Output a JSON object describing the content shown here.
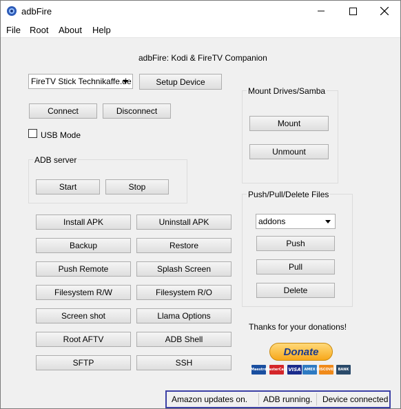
{
  "window": {
    "title": "adbFire"
  },
  "menu": [
    "File",
    "Root",
    "About",
    "Help"
  ],
  "header": "adbFire:  Kodi & FireTV  Companion",
  "device_select": {
    "value": "FireTV Stick Technikaffe.de"
  },
  "buttons": {
    "setup_device": "Setup Device",
    "connect": "Connect",
    "disconnect": "Disconnect",
    "start": "Start",
    "stop": "Stop",
    "install_apk": "Install APK",
    "uninstall_apk": "Uninstall APK",
    "backup": "Backup",
    "restore": "Restore",
    "push_remote": "Push Remote",
    "splash_screen": "Splash Screen",
    "filesystem_rw": "Filesystem R/W",
    "filesystem_ro": "Filesystem R/O",
    "screen_shot": "Screen shot",
    "llama_options": "Llama Options",
    "root_aftv": "Root AFTV",
    "adb_shell": "ADB Shell",
    "sftp": "SFTP",
    "ssh": "SSH",
    "mount": "Mount",
    "unmount": "Unmount",
    "push": "Push",
    "pull": "Pull",
    "delete": "Delete"
  },
  "usb_mode": {
    "label": "USB Mode",
    "checked": false
  },
  "groups": {
    "adb_server": "ADB server",
    "mount_drives": "Mount Drives/Samba",
    "push_pull": "Push/Pull/Delete Files"
  },
  "files_select": {
    "value": "addons"
  },
  "donation": {
    "thanks": "Thanks for your donations!",
    "donate_label": "Donate",
    "cards": [
      "Maestro",
      "MasterCard",
      "VISA",
      "AMEX",
      "DISCOVER",
      "BANK"
    ]
  },
  "status": {
    "amazon": "Amazon updates on.",
    "adb": "ADB running.",
    "device": "Device connected"
  },
  "colors": {
    "status_border": "#3b3fa5",
    "donate_gold": "#f7b733",
    "donate_text": "#1a3a8c"
  }
}
